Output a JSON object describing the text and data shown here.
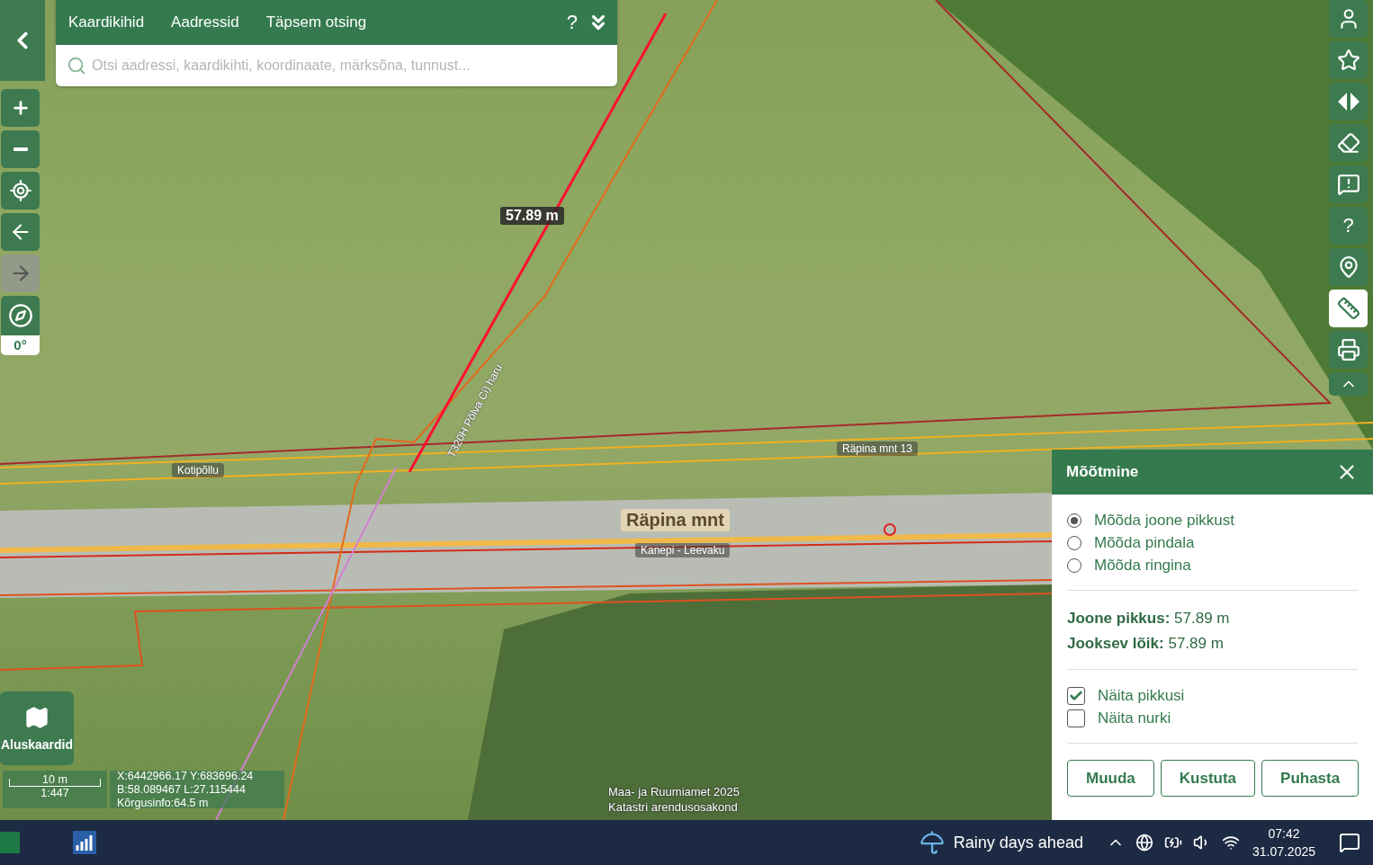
{
  "top_bar": {
    "tabs": [
      {
        "label": "Kaardikihid"
      },
      {
        "label": "Aadressid"
      },
      {
        "label": "Täpsem otsing"
      }
    ],
    "help": "?",
    "search": {
      "placeholder": "Otsi aadressi, kaardikihti, koordinaate, märksõna, tunnust..."
    }
  },
  "left_tools": [
    {
      "kind": "zoom_in",
      "disabled": false
    },
    {
      "kind": "zoom_out",
      "disabled": false
    },
    {
      "kind": "locate",
      "disabled": false
    },
    {
      "kind": "back",
      "disabled": false
    },
    {
      "kind": "forward",
      "disabled": true
    }
  ],
  "compass": {
    "reading": "0°"
  },
  "right_tools": [
    {
      "kind": "user",
      "selected": false
    },
    {
      "kind": "star",
      "selected": false
    },
    {
      "kind": "compare",
      "selected": false
    },
    {
      "kind": "eraser",
      "selected": false
    },
    {
      "kind": "feedback",
      "selected": false
    },
    {
      "kind": "help",
      "selected": false,
      "label": "?"
    },
    {
      "kind": "pin",
      "selected": false
    },
    {
      "kind": "ruler",
      "selected": true
    },
    {
      "kind": "print",
      "selected": false
    },
    {
      "kind": "collapse",
      "selected": false
    }
  ],
  "map_labels": [
    {
      "kind": "measure",
      "text": "57.89 m"
    },
    {
      "kind": "place",
      "text": "Kotipõllu"
    },
    {
      "kind": "place",
      "text": "Räpina mnt 13"
    },
    {
      "kind": "road",
      "text": "Räpina mnt"
    },
    {
      "kind": "place",
      "text": "Kanepi - Leevaku"
    },
    {
      "kind": "line",
      "text": "T320H Põlva Ci) haru"
    }
  ],
  "basemaps": {
    "label": "Aluskaardid"
  },
  "scale": {
    "distance": "10 m",
    "ratio": "1:447"
  },
  "coordinates": [
    "X:6442966.17 Y:683696.24",
    "B:58.089467 L:27.115444",
    "Kõrgusinfo:64.5 m"
  ],
  "attribution": [
    "Maa- ja Ruumiamet 2025",
    "Katastri arendusosakond"
  ],
  "panel": {
    "title": "Mõõtmine",
    "modes": [
      {
        "label": "Mõõda joone pikkust",
        "selected": true
      },
      {
        "label": "Mõõda pindala",
        "selected": false
      },
      {
        "label": "Mõõda ringina",
        "selected": false
      }
    ],
    "results": [
      {
        "label": "Joone pikkus:",
        "value": "57.89 m"
      },
      {
        "label": "Jooksev lõik:",
        "value": "57.89 m"
      }
    ],
    "options": [
      {
        "label": "Näita pikkusi",
        "checked": true
      },
      {
        "label": "Näita nurki",
        "checked": false
      }
    ],
    "buttons": [
      "Muuda",
      "Kustuta",
      "Puhasta"
    ]
  },
  "taskbar": {
    "weather": "Rainy days ahead",
    "time": "07:42",
    "date": "31.07.2025"
  }
}
